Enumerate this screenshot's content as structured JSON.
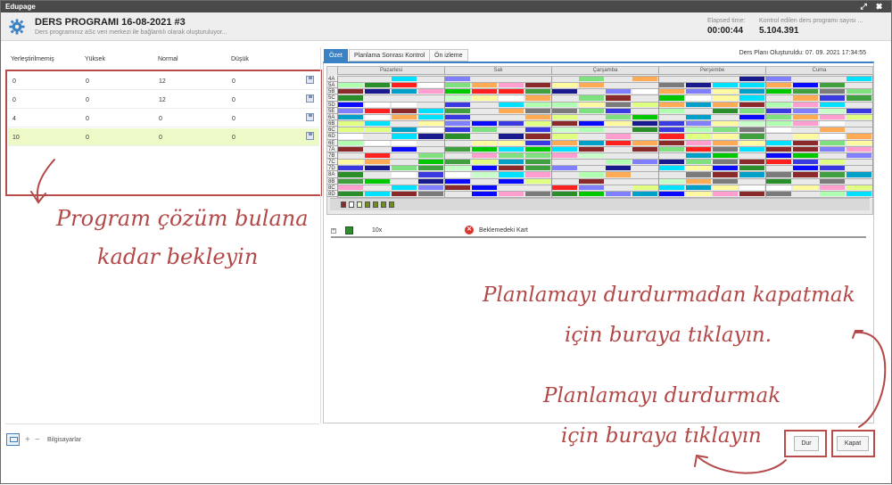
{
  "window": {
    "title": "Edupage",
    "icons": "⤢ ✖"
  },
  "header": {
    "title": "DERS PROGRAMI 16-08-2021 #3",
    "subtitle": "Ders programınız aSc veri merkezi ile bağlantılı olarak oluşturuluyor...",
    "elapsed_label": "Elapsed time:",
    "elapsed_value": "00:00:44",
    "checked_label": "Kontrol edilen ders programı sayısı ...",
    "checked_value": "5.104.391"
  },
  "left_table": {
    "columns": [
      "Yerleştirilmemiş",
      "Yüksek",
      "Normal",
      "Düşük"
    ],
    "rows": [
      [
        "0",
        "0",
        "12",
        "0"
      ],
      [
        "0",
        "0",
        "12",
        "0"
      ],
      [
        "4",
        "0",
        "0",
        "0"
      ],
      [
        "10",
        "0",
        "0",
        "0"
      ]
    ]
  },
  "tabs": [
    "Özet",
    "Planlama Sonrası Kontrol",
    "Ön izleme"
  ],
  "generated": "Ders Planı Oluşturuldu: 07. 09. 2021 17:34:55",
  "grid": {
    "days": [
      "Pazartesi",
      "Salı",
      "Çarşamba",
      "Perşembe",
      "Cuma"
    ],
    "classes": [
      "4A",
      "5A",
      "5B",
      "5C",
      "5D",
      "5E",
      "6A",
      "6B",
      "6C",
      "6D",
      "6E",
      "7A",
      "7B",
      "7C",
      "7D",
      "8A",
      "8B",
      "8C",
      "8D"
    ]
  },
  "event": {
    "count": "10x",
    "text": "Beklemedeki Kart"
  },
  "bottom": {
    "label": "Bilgisayarlar",
    "plus": "+",
    "minus": "−"
  },
  "buttons": {
    "stop": "Dur",
    "close": "Kapat"
  },
  "annotations": {
    "wait": [
      "Program çözüm bulana",
      "kadar bekleyin"
    ],
    "close": [
      "Planlamayı durdurmadan kapatmak",
      "için buraya tıklayın."
    ],
    "stop": [
      "Planlamayı durdurmak",
      "için buraya tıklayın"
    ]
  },
  "colors": {
    "accent": "#3b82c4",
    "annotation": "#b34848",
    "highlight_row": "#eef9c8"
  }
}
